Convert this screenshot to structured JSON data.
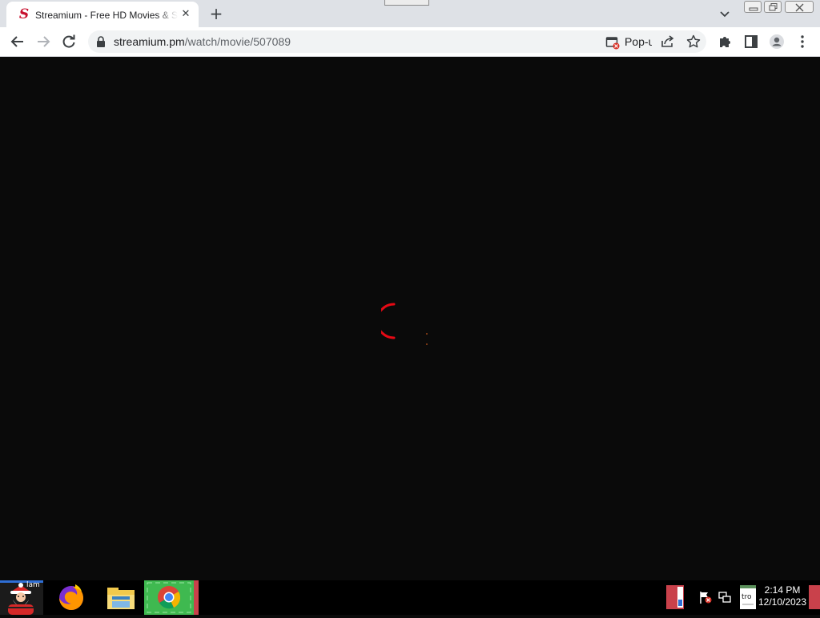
{
  "browser": {
    "tab": {
      "title": "Streamium - Free HD Movies & Shows",
      "favicon_letter": "S",
      "close_glyph": "✕"
    },
    "new_tab_glyph": "+",
    "toolbar": {
      "url_host": "streamium.pm",
      "url_path": "/watch/movie/507089",
      "popup_blocked_label": "Pop-up blocked"
    },
    "icons": [
      "back-icon",
      "forward-icon",
      "reload-icon",
      "lock-icon",
      "popup-blocked-icon",
      "share-icon",
      "bookmark-star-icon",
      "extensions-icon",
      "side-panel-icon",
      "profile-icon",
      "menu-icon"
    ]
  },
  "content": {
    "state": "loading",
    "spinner_color": "#e50914",
    "background": "#0a0a0a"
  },
  "taskbar": {
    "apps": [
      "santa-start-icon",
      "firefox-icon",
      "file-explorer-icon",
      "chrome-icon"
    ],
    "start_overlay_text": "lam",
    "tray_overlay_text": "tro",
    "clock": {
      "time": "2:14 PM",
      "date": "12/10/2023"
    }
  }
}
